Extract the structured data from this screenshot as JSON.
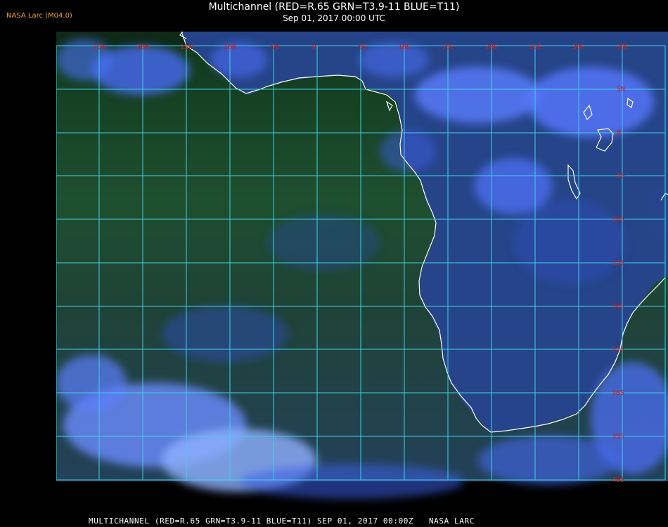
{
  "header": {
    "brand": "NASA Larc (M04.0)",
    "title": "Multichannel (RED=R.65 GRN=T3.9-11 BLUE=T11)",
    "subtitle": "Sep 01, 2017 00:00 UTC"
  },
  "footer": {
    "caption": "MULTICHANNEL (RED=R.65 GRN=T3.9-11 BLUE=T11) SEP 01, 2017 00:00Z   NASA LARC"
  },
  "map": {
    "lon_labels": [
      "25W",
      "20W",
      "15W",
      "10W",
      "5W",
      "0",
      "5E",
      "10E",
      "15E",
      "20E",
      "25E",
      "30E",
      "35E"
    ],
    "lat_labels": [
      "5N",
      "0",
      "5S",
      "10S",
      "15S",
      "20S",
      "25S",
      "30S",
      "35S",
      "40S"
    ],
    "colors": {
      "grid": "#3fd2e6",
      "label": "#d81818",
      "coast": "#ffffff",
      "ocean": "#1d4a2a",
      "land": "#23418a",
      "cloud": "#5a7aff"
    }
  }
}
